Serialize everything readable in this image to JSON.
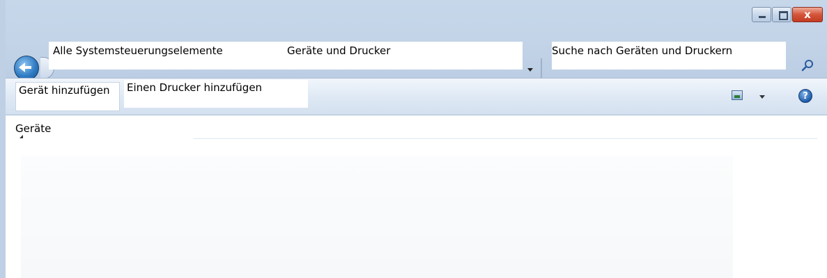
{
  "window": {
    "caption_buttons": {
      "minimize_icon": "minimize-icon",
      "maximize_icon": "maximize-icon",
      "close_glyph": "x"
    }
  },
  "address_bar": {
    "breadcrumbs": [
      {
        "label": "Alle Systemsteuerungselemente"
      },
      {
        "label": "Geräte und Drucker"
      }
    ]
  },
  "search": {
    "placeholder": "Suche nach Geräten und Druckern"
  },
  "toolbar": {
    "add_device_label": "Gerät hinzufügen",
    "add_printer_label": "Einen Drucker hinzufügen",
    "help_glyph": "?"
  },
  "content": {
    "group_header": "Geräte"
  }
}
